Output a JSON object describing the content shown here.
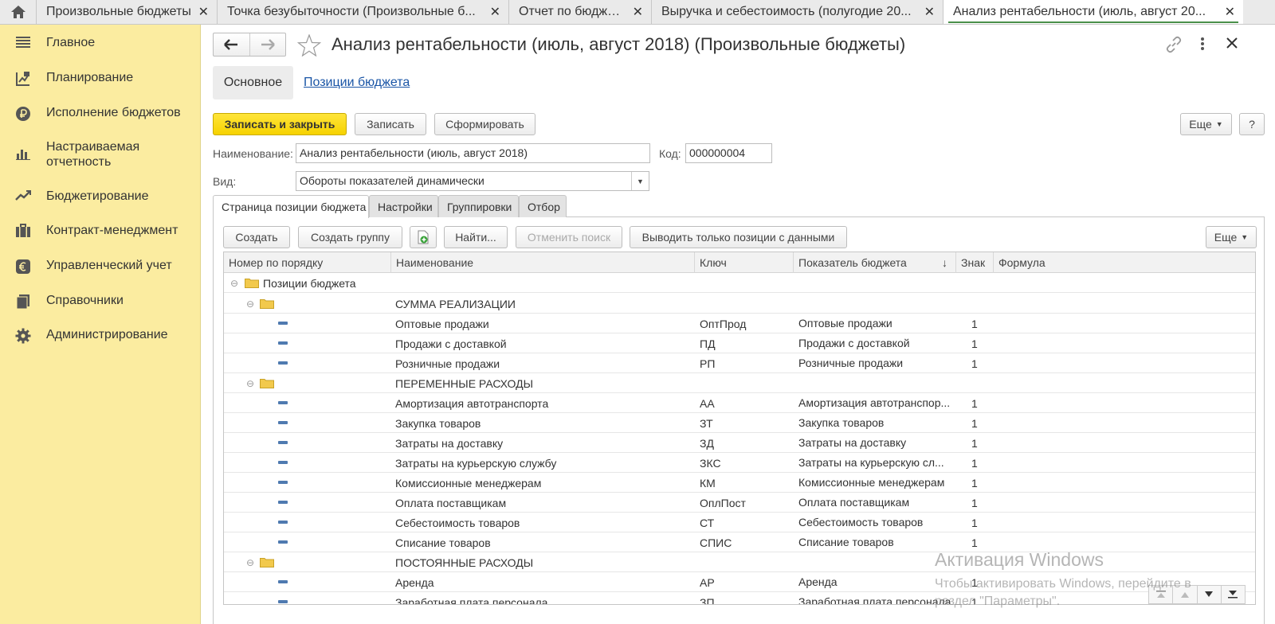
{
  "top_tabs": [
    {
      "label": "Произвольные бюджеты",
      "active": false
    },
    {
      "label": "Точка безубыточности (Произвольные б...",
      "active": false
    },
    {
      "label": "Отчет по бюджету",
      "active": false
    },
    {
      "label": "Выручка и себестоимость (полугодие 20...",
      "active": false
    },
    {
      "label": "Анализ рентабельности (июль, август 20...",
      "active": true
    }
  ],
  "tab_close_glyph": "✕",
  "sidebar": {
    "items": [
      {
        "label": "Главное",
        "icon": "menu-lines-icon"
      },
      {
        "label": "Планирование",
        "icon": "planning-chart-icon"
      },
      {
        "label": "Исполнение бюджетов",
        "icon": "ruble-coin-icon"
      },
      {
        "label": "Настраиваемая отчетность",
        "icon": "bar-chart-icon"
      },
      {
        "label": "Бюджетирование",
        "icon": "trend-line-icon"
      },
      {
        "label": "Контракт-менеджмент",
        "icon": "briefcase-icon"
      },
      {
        "label": "Управленческий учет",
        "icon": "euro-coin-icon"
      },
      {
        "label": "Справочники",
        "icon": "books-icon"
      },
      {
        "label": "Администрирование",
        "icon": "gear-icon"
      }
    ]
  },
  "header": {
    "title": "Анализ рентабельности (июль, август 2018) (Произвольные бюджеты)"
  },
  "section_tabs": {
    "main": "Основное",
    "link": "Позиции бюджета"
  },
  "toolbar": {
    "save_close": "Записать и закрыть",
    "save": "Записать",
    "generate": "Сформировать",
    "more": "Еще",
    "help": "?"
  },
  "form": {
    "name_label": "Наименование:",
    "name_value": "Анализ рентабельности (июль, август 2018)",
    "code_label": "Код:",
    "code_value": "000000004",
    "kind_label": "Вид:",
    "kind_value": "Обороты показателей динамически"
  },
  "inner_tabs": [
    {
      "label": "Страница позиции бюджета",
      "active": true
    },
    {
      "label": "Настройки",
      "active": false
    },
    {
      "label": "Группировки",
      "active": false
    },
    {
      "label": "Отбор",
      "active": false
    }
  ],
  "grid_toolbar": {
    "create": "Создать",
    "create_group": "Создать группу",
    "find": "Найти...",
    "cancel_search": "Отменить поиск",
    "only_with_data": "Выводить только позиции с данными",
    "more": "Еще"
  },
  "table": {
    "columns": [
      "Номер по порядку",
      "Наименование",
      "Ключ",
      "Показатель бюджета",
      "Знак",
      "Формула"
    ],
    "sort_marker": "↓",
    "root_label": "Позиции бюджета",
    "rows": [
      {
        "type": "group",
        "name": "СУММА РЕАЛИЗАЦИИ"
      },
      {
        "type": "item",
        "name": "Оптовые продажи",
        "key": "ОптПрод",
        "indicator": "Оптовые продажи",
        "sign": "1"
      },
      {
        "type": "item",
        "name": "Продажи с доставкой",
        "key": "ПД",
        "indicator": "Продажи с доставкой",
        "sign": "1"
      },
      {
        "type": "item",
        "name": "Розничные продажи",
        "key": "РП",
        "indicator": "Розничные продажи",
        "sign": "1"
      },
      {
        "type": "group",
        "name": "ПЕРЕМЕННЫЕ РАСХОДЫ"
      },
      {
        "type": "item",
        "name": "Амортизация автотранспорта",
        "key": "АА",
        "indicator": "Амортизация автотранспор...",
        "sign": "1"
      },
      {
        "type": "item",
        "name": "Закупка товаров",
        "key": "ЗТ",
        "indicator": "Закупка товаров",
        "sign": "1"
      },
      {
        "type": "item",
        "name": "Затраты на доставку",
        "key": "ЗД",
        "indicator": "Затраты на доставку",
        "sign": "1"
      },
      {
        "type": "item",
        "name": "Затраты на курьерскую службу",
        "key": "ЗКС",
        "indicator": "Затраты на курьерскую сл...",
        "sign": "1"
      },
      {
        "type": "item",
        "name": "Комиссионные менеджерам",
        "key": "КМ",
        "indicator": "Комиссионные менеджерам",
        "sign": "1"
      },
      {
        "type": "item",
        "name": "Оплата поставщикам",
        "key": "ОплПост",
        "indicator": "Оплата поставщикам",
        "sign": "1"
      },
      {
        "type": "item",
        "name": "Себестоимость товаров",
        "key": "СТ",
        "indicator": "Себестоимость товаров",
        "sign": "1"
      },
      {
        "type": "item",
        "name": "Списание товаров",
        "key": "СПИС",
        "indicator": "Списание товаров",
        "sign": "1"
      },
      {
        "type": "group",
        "name": "ПОСТОЯННЫЕ РАСХОДЫ"
      },
      {
        "type": "item",
        "name": "Аренда",
        "key": "АР",
        "indicator": "Аренда",
        "sign": "1"
      },
      {
        "type": "item",
        "name": "Заработная плата персонала",
        "key": "ЗП",
        "indicator": "Заработная плата персонала",
        "sign": "1"
      }
    ]
  },
  "watermark": {
    "title": "Активация Windows",
    "line1": "Чтобы активировать Windows, перейдите в",
    "line2": "раздел \"Параметры\"."
  },
  "colors": {
    "sidebar_bg": "#fbeca0",
    "primary_button": "#f6d200",
    "link": "#1a55a6",
    "row_icon": "#4f7ab0",
    "folder": "#f2c94c"
  }
}
